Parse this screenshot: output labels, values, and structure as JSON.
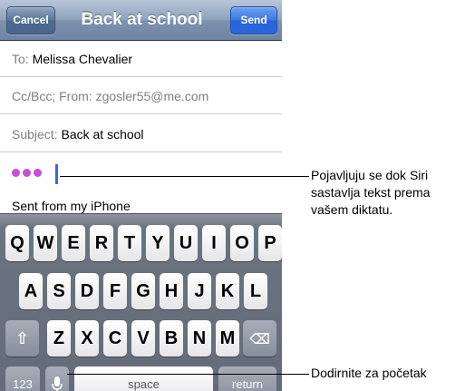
{
  "nav": {
    "cancel_label": "Cancel",
    "title": "Back at school",
    "send_label": "Send"
  },
  "fields": {
    "to_label": "To:",
    "to_value": "Melissa Chevalier",
    "cc_label": "Cc/Bcc; From:",
    "cc_value": "zgosler55@me.com",
    "subject_label": "Subject:",
    "subject_value": "Back at school"
  },
  "body": {
    "signature": "Sent from my iPhone",
    "dictation_dot_color": "#c94bd6"
  },
  "keyboard": {
    "row1": [
      "Q",
      "W",
      "E",
      "R",
      "T",
      "Y",
      "U",
      "I",
      "O",
      "P"
    ],
    "row2": [
      "A",
      "S",
      "D",
      "F",
      "G",
      "H",
      "J",
      "K",
      "L"
    ],
    "row3": [
      "Z",
      "X",
      "C",
      "V",
      "B",
      "N",
      "M"
    ],
    "shift_icon": "shift-arrow-icon",
    "delete_icon": "delete-backspace-icon",
    "numbers_label": "123",
    "mic_icon": "microphone-icon",
    "space_label": "space",
    "return_label": "return"
  },
  "callouts": {
    "dictation_line1": "Pojavljuju se dok Siri",
    "dictation_line2": "sastavlja tekst prema",
    "dictation_line3": "vašem diktatu.",
    "mic": "Dodirnite za početak"
  }
}
